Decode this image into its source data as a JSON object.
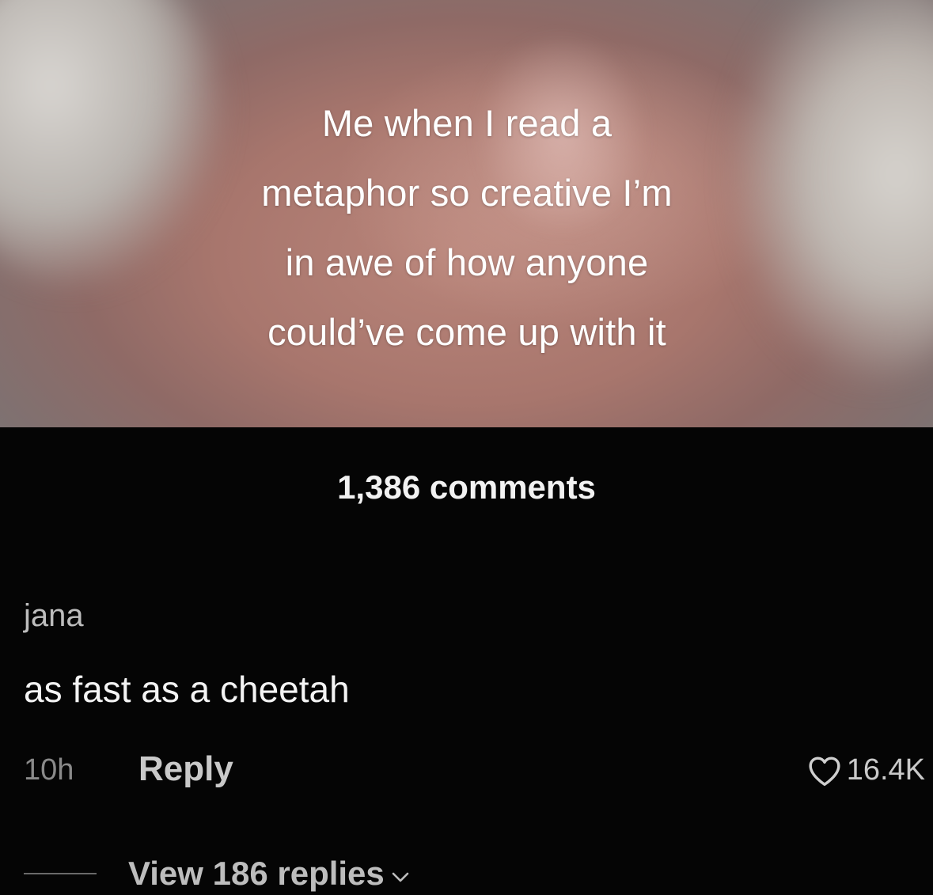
{
  "video": {
    "caption": "Me when I read a\nmetaphor so creative I’m\nin awe of how anyone\ncould’ve come up with it"
  },
  "comments_panel": {
    "count_label": "1,386 comments"
  },
  "comment": {
    "username": "jana",
    "text": "as fast as a cheetah",
    "time": "10h",
    "reply_label": "Reply",
    "like_count": "16.4K",
    "view_replies_label": "View 186 replies"
  },
  "icons": {
    "like": "heart-icon",
    "expand": "chevron-down-icon"
  },
  "colors": {
    "background": "#050505",
    "primary_text": "#f4f4f4",
    "secondary_text": "#8a8a8a"
  }
}
